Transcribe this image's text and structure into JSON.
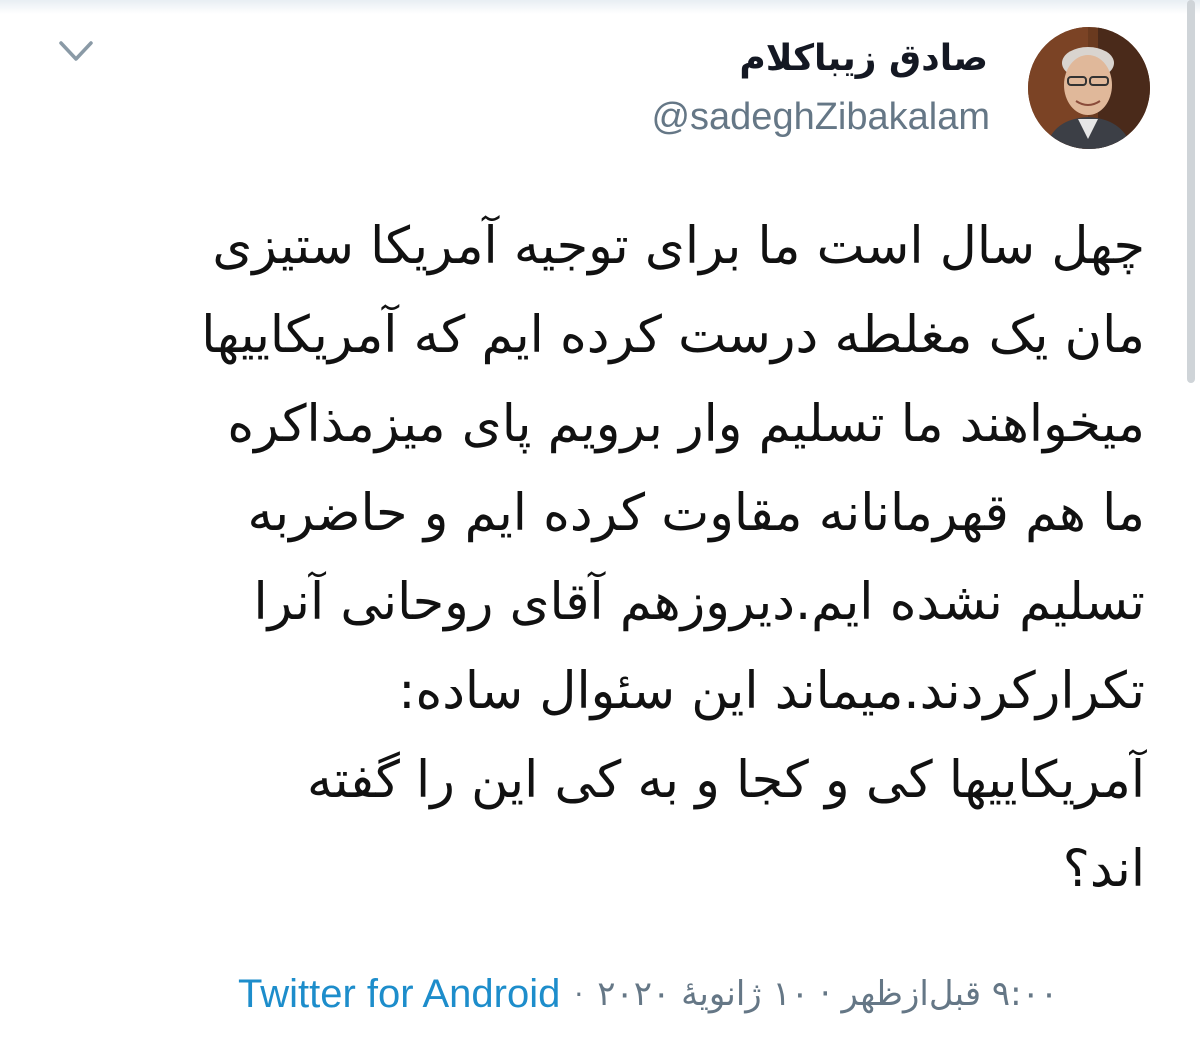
{
  "header": {
    "display_name": "صادق زیباکلام",
    "handle": "@sadeghZibakalam"
  },
  "tweet": {
    "lines": [
      "چهل سال است ما برای توجیه آمریکا ستیزی",
      "مان یک مغلطه درست کرده ایم که آمریکاییها",
      "میخواهند ما تسلیم وار برویم پای میزمذاکره",
      "ما هم قهرمانانه مقاوت کرده ایم و حاضربه",
      "تسلیم نشده ایم.دیروزهم آقای روحانی آنرا",
      "تکرارکردند.میماند این سئوال ساده:",
      "آمریکاییها کی و کجا و به کی این را گفته",
      "اند؟"
    ]
  },
  "footer": {
    "timestamp": "۹:۰۰ قبل‌ازظهر · ۱۰ ژانویهٔ ۲۰۲۰",
    "separator": "·",
    "source": "Twitter for Android"
  },
  "colors": {
    "text": "#141823",
    "secondary": "#657786",
    "link": "#1d8dcb"
  },
  "icons": {
    "chevron": "chevron-down-icon"
  }
}
